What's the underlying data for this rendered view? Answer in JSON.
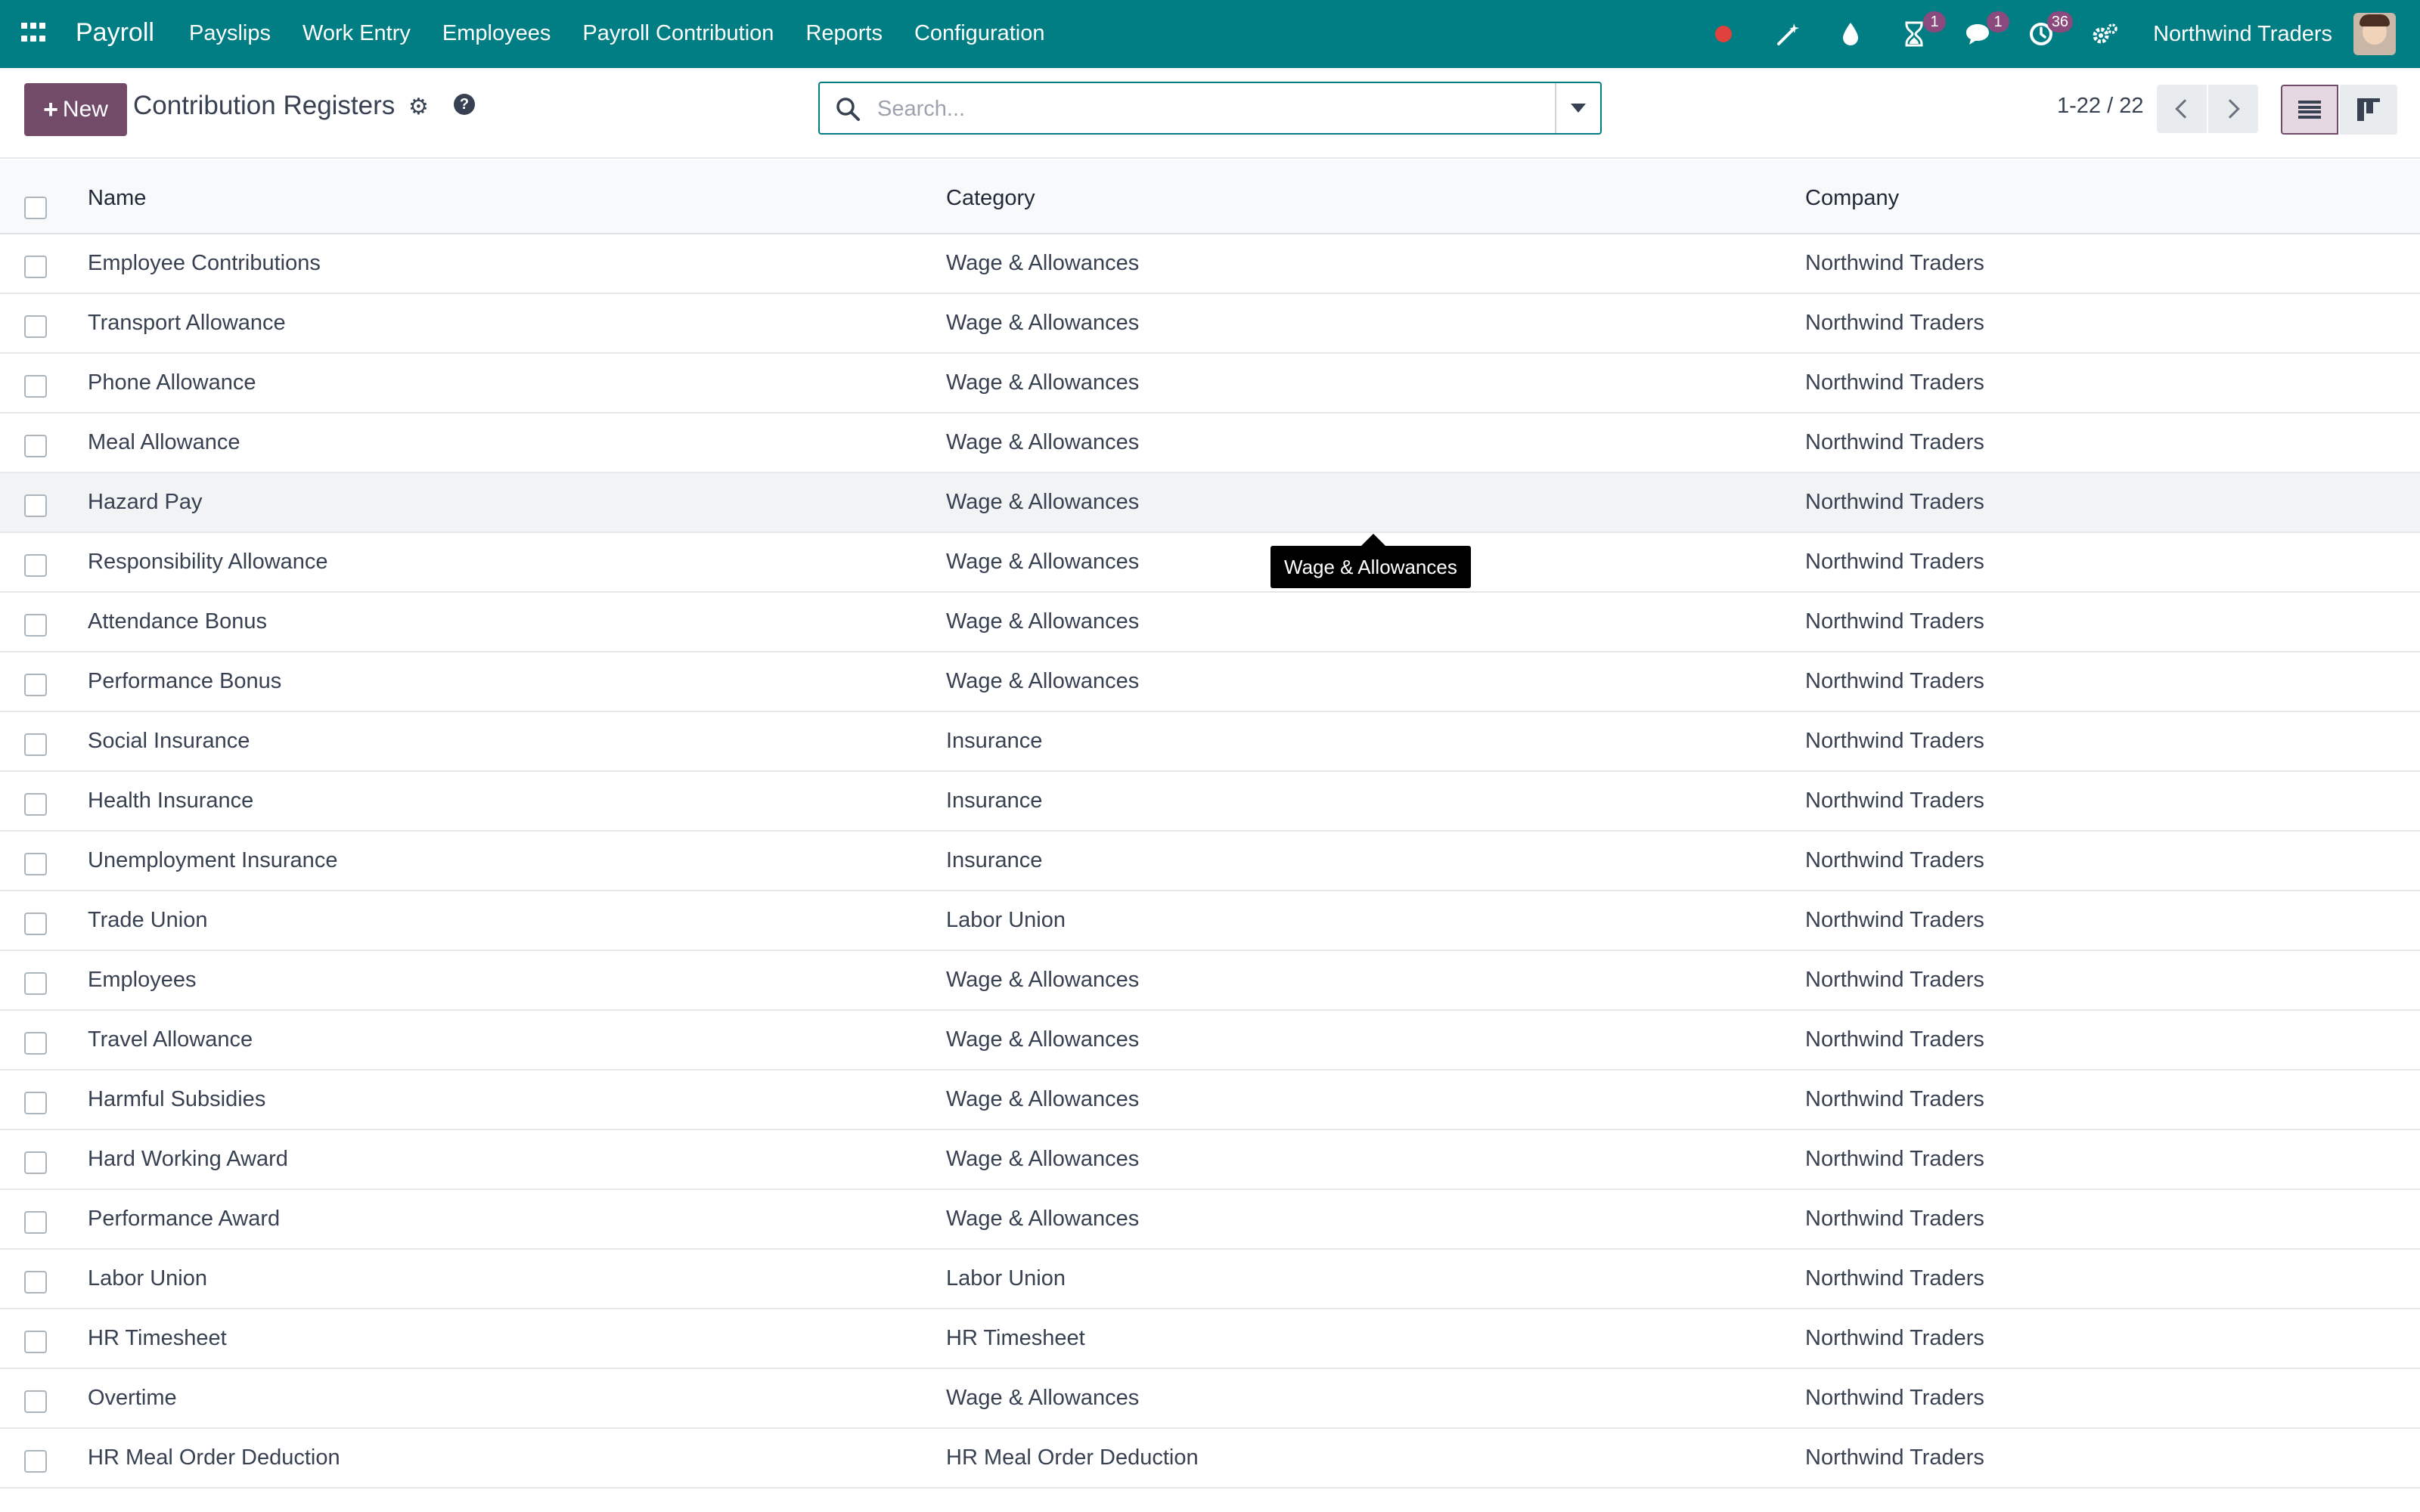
{
  "navbar": {
    "app_name": "Payroll",
    "menu": [
      "Payslips",
      "Work Entry",
      "Employees",
      "Payroll Contribution",
      "Reports",
      "Configuration"
    ],
    "badges": {
      "activity": "1",
      "messages": "1",
      "clock": "36"
    },
    "company": "Northwind Traders",
    "icons": [
      "apps-icon",
      "record-icon",
      "magic-wand-icon",
      "drop-icon",
      "hourglass-icon",
      "messages-icon",
      "clock-icon",
      "settings-icon"
    ]
  },
  "control_panel": {
    "new_label": "New",
    "title": "Contribution Registers",
    "search_placeholder": "Search...",
    "pager": "1-22 / 22"
  },
  "table": {
    "headers": {
      "name": "Name",
      "category": "Category",
      "company": "Company"
    },
    "rows": [
      {
        "name": "Employee Contributions",
        "category": "Wage & Allowances",
        "company": "Northwind Traders"
      },
      {
        "name": "Transport Allowance",
        "category": "Wage & Allowances",
        "company": "Northwind Traders"
      },
      {
        "name": "Phone Allowance",
        "category": "Wage & Allowances",
        "company": "Northwind Traders"
      },
      {
        "name": "Meal Allowance",
        "category": "Wage & Allowances",
        "company": "Northwind Traders"
      },
      {
        "name": "Hazard Pay",
        "category": "Wage & Allowances",
        "company": "Northwind Traders"
      },
      {
        "name": "Responsibility Allowance",
        "category": "Wage & Allowances",
        "company": "Northwind Traders"
      },
      {
        "name": "Attendance Bonus",
        "category": "Wage & Allowances",
        "company": "Northwind Traders"
      },
      {
        "name": "Performance Bonus",
        "category": "Wage & Allowances",
        "company": "Northwind Traders"
      },
      {
        "name": "Social Insurance",
        "category": "Insurance",
        "company": "Northwind Traders"
      },
      {
        "name": "Health Insurance",
        "category": "Insurance",
        "company": "Northwind Traders"
      },
      {
        "name": "Unemployment Insurance",
        "category": "Insurance",
        "company": "Northwind Traders"
      },
      {
        "name": "Trade Union",
        "category": "Labor Union",
        "company": "Northwind Traders"
      },
      {
        "name": "Employees",
        "category": "Wage & Allowances",
        "company": "Northwind Traders"
      },
      {
        "name": "Travel Allowance",
        "category": "Wage & Allowances",
        "company": "Northwind Traders"
      },
      {
        "name": "Harmful Subsidies",
        "category": "Wage & Allowances",
        "company": "Northwind Traders"
      },
      {
        "name": "Hard Working Award",
        "category": "Wage & Allowances",
        "company": "Northwind Traders"
      },
      {
        "name": "Performance Award",
        "category": "Wage & Allowances",
        "company": "Northwind Traders"
      },
      {
        "name": "Labor Union",
        "category": "Labor Union",
        "company": "Northwind Traders"
      },
      {
        "name": "HR Timesheet",
        "category": "HR Timesheet",
        "company": "Northwind Traders"
      },
      {
        "name": "Overtime",
        "category": "Wage & Allowances",
        "company": "Northwind Traders"
      },
      {
        "name": "HR Meal Order Deduction",
        "category": "HR Meal Order Deduction",
        "company": "Northwind Traders"
      }
    ]
  },
  "tooltip": "Wage & Allowances",
  "colors": {
    "navbar": "#017e84",
    "primary": "#714b67",
    "badge": "#8a4a7d",
    "record": "#e0413c"
  }
}
